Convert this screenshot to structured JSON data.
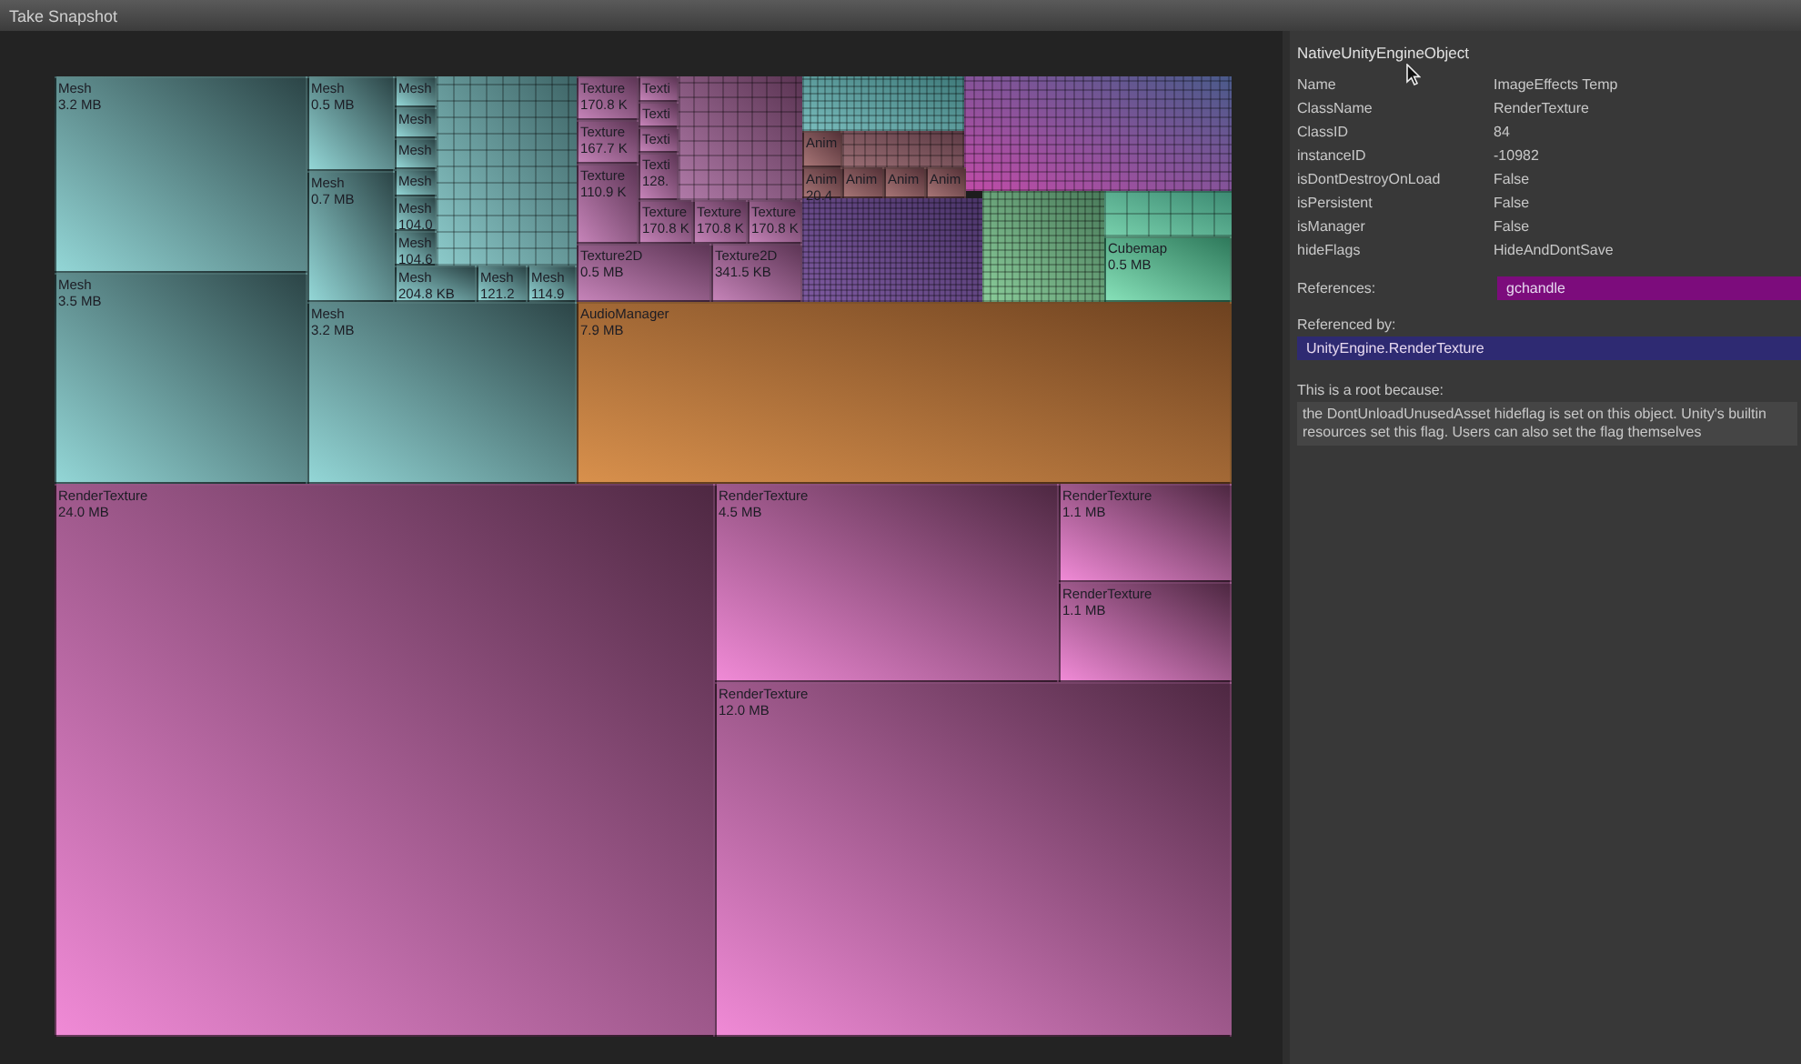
{
  "window": {
    "title": "Take Snapshot"
  },
  "treemap": {
    "cells": [
      {
        "label": "Mesh",
        "size": "3.2 MB",
        "kind": "mesh"
      },
      {
        "label": "Mesh",
        "size": "3.5 MB",
        "kind": "mesh"
      },
      {
        "label": "Mesh",
        "size": "0.5 MB",
        "kind": "mesh"
      },
      {
        "label": "Mesh",
        "size": "0.7 MB",
        "kind": "mesh"
      },
      {
        "label": "Mesh",
        "kind": "mesh"
      },
      {
        "label": "Mesh",
        "kind": "mesh"
      },
      {
        "label": "Mesh",
        "kind": "mesh"
      },
      {
        "label": "Mesh",
        "kind": "mesh"
      },
      {
        "label": "Mesh",
        "size": "104.0",
        "kind": "mesh"
      },
      {
        "label": "Mesh",
        "size": "104.6",
        "kind": "mesh"
      },
      {
        "label": "Mesh",
        "size": "204.8 KB",
        "kind": "mesh"
      },
      {
        "label": "Mesh",
        "size": "121.2",
        "kind": "mesh"
      },
      {
        "label": "Mesh",
        "size": "114.9",
        "kind": "mesh"
      },
      {
        "label": "Mesh",
        "size": "3.2 MB",
        "kind": "mesh"
      },
      {
        "label": "Texture",
        "size": "170.8 K",
        "kind": "texture"
      },
      {
        "label": "Texture",
        "size": "167.7 K",
        "kind": "texture"
      },
      {
        "label": "Texture",
        "size": "110.9 K",
        "kind": "texture"
      },
      {
        "label": "Texture2D",
        "size": "0.5 MB",
        "kind": "texture"
      },
      {
        "label": "Texture2D",
        "size": "341.5 KB",
        "kind": "texture"
      },
      {
        "label": "Texti",
        "kind": "texture"
      },
      {
        "label": "Texti",
        "kind": "texture"
      },
      {
        "label": "Texti",
        "kind": "texture"
      },
      {
        "label": "Texti",
        "size": "128.",
        "kind": "texture"
      },
      {
        "label": "Texture",
        "size": "170.8 K",
        "kind": "texture"
      },
      {
        "label": "Texture",
        "size": "170.8 K",
        "kind": "texture"
      },
      {
        "label": "Texture",
        "size": "170.8 K",
        "kind": "texture"
      },
      {
        "label": "Anim",
        "kind": "anim"
      },
      {
        "label": "Anim",
        "size": "20.4",
        "kind": "anim"
      },
      {
        "label": "Anim",
        "kind": "anim"
      },
      {
        "label": "Anim",
        "kind": "anim"
      },
      {
        "label": "Anim",
        "kind": "anim"
      },
      {
        "label": "Cubemap",
        "size": "0.5 MB",
        "kind": "cubemap"
      },
      {
        "label": "AudioManager",
        "size": "7.9 MB",
        "kind": "audio"
      },
      {
        "label": "RenderTexture",
        "size": "24.0 MB",
        "kind": "render"
      },
      {
        "label": "RenderTexture",
        "size": "4.5 MB",
        "kind": "render"
      },
      {
        "label": "RenderTexture",
        "size": "1.1 MB",
        "kind": "render"
      },
      {
        "label": "RenderTexture",
        "size": "1.1 MB",
        "kind": "render"
      },
      {
        "label": "RenderTexture",
        "size": "12.0 MB",
        "kind": "render"
      }
    ]
  },
  "inspector": {
    "title": "NativeUnityEngineObject",
    "properties": [
      {
        "key": "Name",
        "value": "ImageEffects Temp"
      },
      {
        "key": "ClassName",
        "value": "RenderTexture"
      },
      {
        "key": "ClassID",
        "value": "84"
      },
      {
        "key": "instanceID",
        "value": "-10982"
      },
      {
        "key": "isDontDestroyOnLoad",
        "value": "False"
      },
      {
        "key": "isPersistent",
        "value": "False"
      },
      {
        "key": "isManager",
        "value": "False"
      },
      {
        "key": "hideFlags",
        "value": "HideAndDontSave"
      }
    ],
    "references_label": "References:",
    "references": [
      "gchandle"
    ],
    "referenced_by_label": "Referenced by:",
    "referenced_by": [
      "UnityEngine.RenderTexture"
    ],
    "root_reason_label": "This is a root because:",
    "root_reason": "the DontUnloadUnusedAsset hideflag is set on this object. Unity's builtin resources set this flag. Users can also set the flag themselves"
  }
}
